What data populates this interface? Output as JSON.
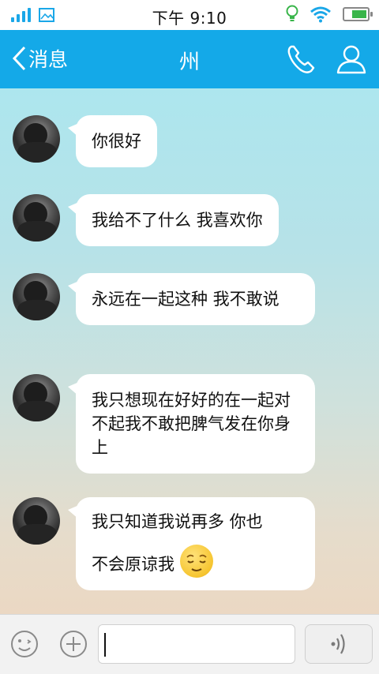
{
  "status_bar": {
    "time": "下午 9:10",
    "icons": [
      "signal-icon",
      "image-icon",
      "bulb-icon",
      "wifi-icon",
      "battery-icon"
    ],
    "accent": "#1aa7e8"
  },
  "header": {
    "back_label": "消息",
    "title": "州",
    "background": "#14a9e8",
    "icons": [
      "back-chevron-icon",
      "phone-icon",
      "profile-icon"
    ]
  },
  "messages": [
    {
      "text": "你很好"
    },
    {
      "text": "我给不了什么  我喜欢你"
    },
    {
      "text": "永远在一起这种  我不敢说"
    },
    {
      "text": "我只想现在好好的在一起对不起我不敢把脾气发在你身上"
    },
    {
      "line1": "我只知道我说再多 你也",
      "line2": "不会原谅我",
      "emoji": "relieved-face-emoji"
    }
  ],
  "input_bar": {
    "value": "",
    "icons": [
      "emoji-face-icon",
      "plus-icon",
      "voice-icon"
    ]
  }
}
